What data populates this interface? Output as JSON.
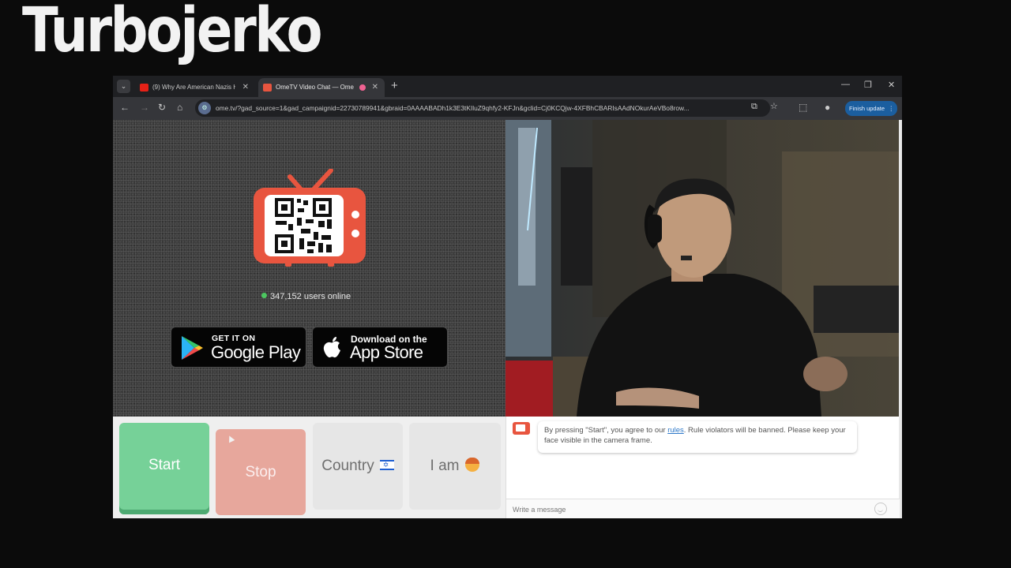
{
  "overlay": {
    "title": "Turbojerko"
  },
  "browser": {
    "tabs": [
      {
        "label": "(9) Why Are American Nazis Ha",
        "icon": "youtube-icon",
        "active": false
      },
      {
        "label": "OmeTV Video Chat — Ome",
        "icon": "ometv-icon",
        "active": true
      }
    ],
    "url": "ome.tv/?gad_source=1&gad_campaignid=22730789941&gbraid=0AAAABADh1k3E3tKIluZ9qhfy2-KFJn&gclid=Cj0KCQjw-4XFBhCBARIsAAdNOkurAeVBo8row...",
    "finish_update_label": "Finish update",
    "tab_close_glyph": "✕",
    "new_tab_glyph": "+"
  },
  "ome": {
    "users_online_count": "347,152",
    "users_online_suffix": "users online",
    "google_play": {
      "small": "GET IT ON",
      "big": "Google Play"
    },
    "app_store": {
      "small": "Download on the",
      "big": "App Store"
    },
    "buttons": {
      "start": "Start",
      "stop": "Stop",
      "country": "Country",
      "i_am": "I am"
    },
    "chat": {
      "message_pre": "By pressing \"Start\", you agree to our ",
      "rules_link": "rules",
      "message_post": ". Rule violators will be banned. Please keep your face visible in the camera frame.",
      "placeholder": "Write a message"
    }
  },
  "colors": {
    "start_green": "#76d198",
    "stop_red": "#e7a79c",
    "tv_orange": "#e8553f",
    "online_green": "#4cc760",
    "finish_update_blue": "#1b5e9f"
  }
}
